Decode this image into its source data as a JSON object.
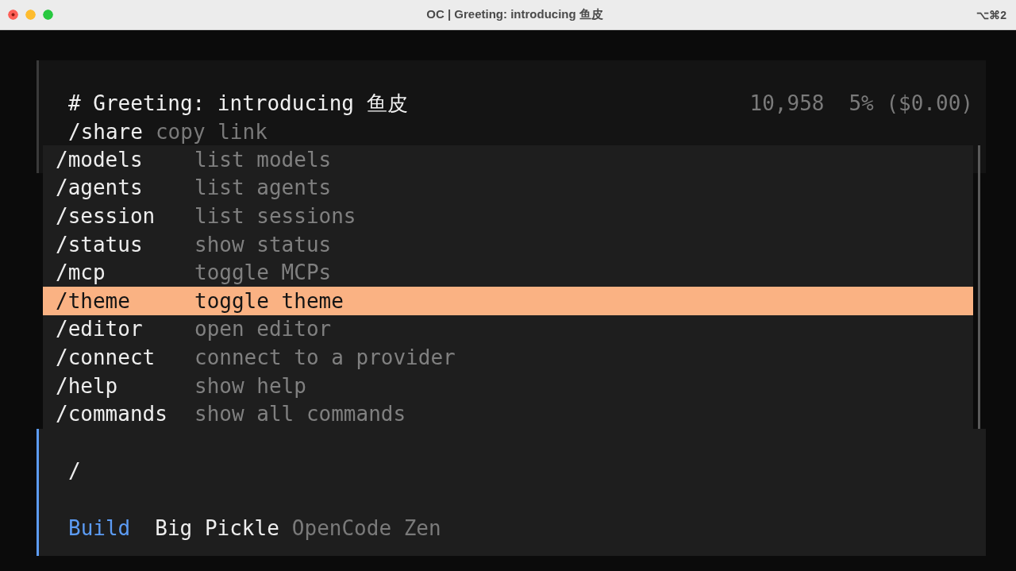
{
  "window": {
    "title": "OC | Greeting: introducing 鱼皮",
    "shortcut": "⌥⌘2"
  },
  "session": {
    "title": "# Greeting: introducing 鱼皮",
    "tokens": "10,958",
    "usage": "5% ($0.00)",
    "hint_command": "/share",
    "hint_text": "copy link"
  },
  "commands": [
    {
      "command": "/models",
      "description": "list models",
      "selected": false
    },
    {
      "command": "/agents",
      "description": "list agents",
      "selected": false
    },
    {
      "command": "/session",
      "description": "list sessions",
      "selected": false
    },
    {
      "command": "/status",
      "description": "show status",
      "selected": false
    },
    {
      "command": "/mcp",
      "description": "toggle MCPs",
      "selected": false
    },
    {
      "command": "/theme",
      "description": "toggle theme",
      "selected": true
    },
    {
      "command": "/editor",
      "description": "open editor",
      "selected": false
    },
    {
      "command": "/connect",
      "description": "connect to a provider",
      "selected": false
    },
    {
      "command": "/help",
      "description": "show help",
      "selected": false
    },
    {
      "command": "/commands",
      "description": "show all commands",
      "selected": false
    }
  ],
  "prompt": {
    "value": "/",
    "agent": "Build",
    "model": "Big Pickle",
    "provider": "OpenCode Zen"
  }
}
